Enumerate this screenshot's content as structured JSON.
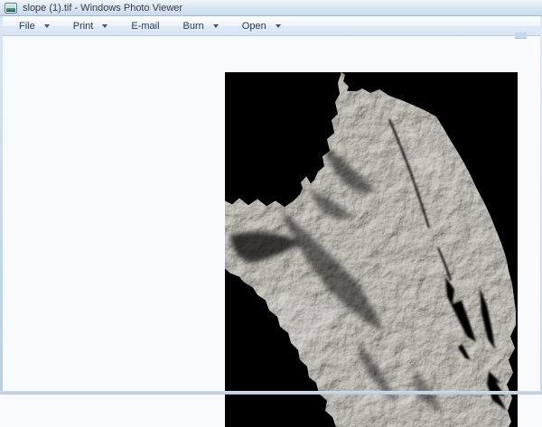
{
  "window": {
    "title": "slope (1).tif - Windows Photo Viewer",
    "app_name": "Windows Photo Viewer",
    "file_name": "slope (1).tif"
  },
  "menubar": {
    "items": [
      {
        "label": "File",
        "has_dropdown": true
      },
      {
        "label": "Print",
        "has_dropdown": true
      },
      {
        "label": "E-mail",
        "has_dropdown": false
      },
      {
        "label": "Burn",
        "has_dropdown": true
      },
      {
        "label": "Open",
        "has_dropdown": true
      }
    ]
  },
  "viewer": {
    "image_description": "Grayscale slope raster map (hillshade-style terrain with dark valleys and rift cracks) displayed on a black background, right-aligned in the viewer",
    "canvas_background": "#000000"
  },
  "colors": {
    "titlebar_gradient_top": "#f1f6fc",
    "titlebar_gradient_bottom": "#c9daed",
    "menubar_border": "#bdccde",
    "menu_text": "#1c3a5e",
    "page_background": "#f8fafc",
    "window_border": "#c3d4e7"
  }
}
